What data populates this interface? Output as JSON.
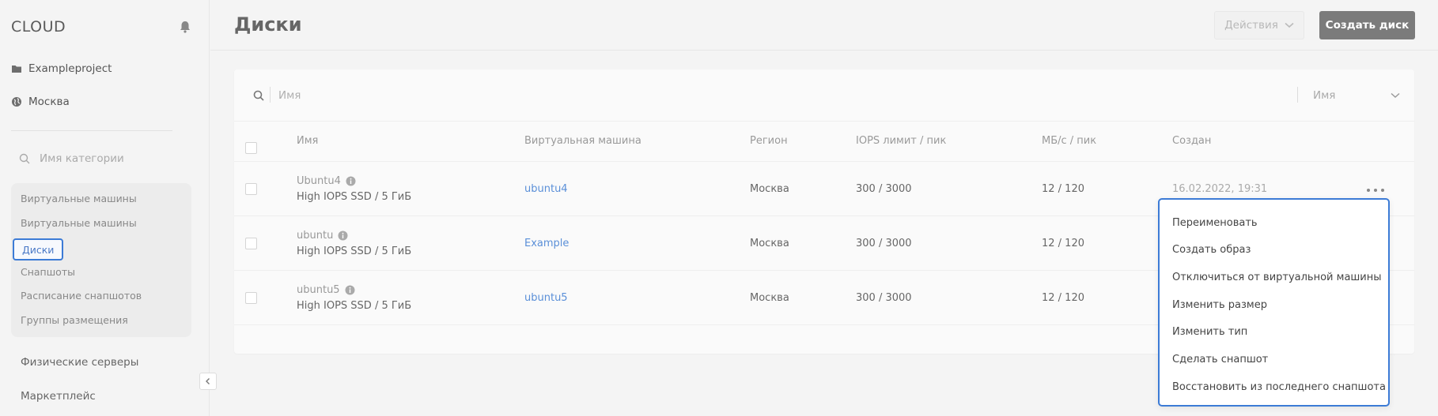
{
  "app": {
    "logo": "CLOUD"
  },
  "sidebar": {
    "project": "Exampleproject",
    "region": "Москва",
    "category_search_placeholder": "Имя категории",
    "items": [
      {
        "label": "Виртуальные машины"
      },
      {
        "label": "Виртуальные машины"
      },
      {
        "label": "Диски"
      },
      {
        "label": "Снапшоты"
      },
      {
        "label": "Расписание снапшотов"
      },
      {
        "label": "Группы размещения"
      }
    ],
    "physical_servers": "Физические серверы",
    "marketplace": "Маркетплейс"
  },
  "header": {
    "title": "Диски",
    "actions_label": "Действия",
    "create_label": "Создать диск"
  },
  "search": {
    "placeholder": "Имя",
    "sort_label": "Имя"
  },
  "table": {
    "columns": [
      "Имя",
      "Виртуальная машина",
      "Регион",
      "IOPS лимит / пик",
      "МБ/с / пик",
      "Создан"
    ],
    "rows": [
      {
        "name": "Ubuntu4",
        "type": "High IOPS SSD / 5 ГиБ",
        "vm": "ubuntu4",
        "region": "Москва",
        "iops": "300 / 3000",
        "mbps": "12 / 120",
        "created": "16.02.2022, 19:31"
      },
      {
        "name": "ubuntu",
        "type": "High IOPS SSD / 5 ГиБ",
        "vm": "Example",
        "region": "Москва",
        "iops": "300 / 3000",
        "mbps": "12 / 120",
        "created": ""
      },
      {
        "name": "ubuntu5",
        "type": "High IOPS SSD / 5 ГиБ",
        "vm": "ubuntu5",
        "region": "Москва",
        "iops": "300 / 3000",
        "mbps": "12 / 120",
        "created": ""
      }
    ]
  },
  "context_menu": {
    "items": [
      "Переименовать",
      "Создать образ",
      "Отключиться от виртуальной машины",
      "Изменить размер",
      "Изменить тип",
      "Сделать снапшот",
      "Восстановить из последнего снапшота"
    ]
  },
  "colors": {
    "accent": "#3c7bd6",
    "link": "#5a8fd8",
    "primary_button": "#7b7b7b"
  }
}
